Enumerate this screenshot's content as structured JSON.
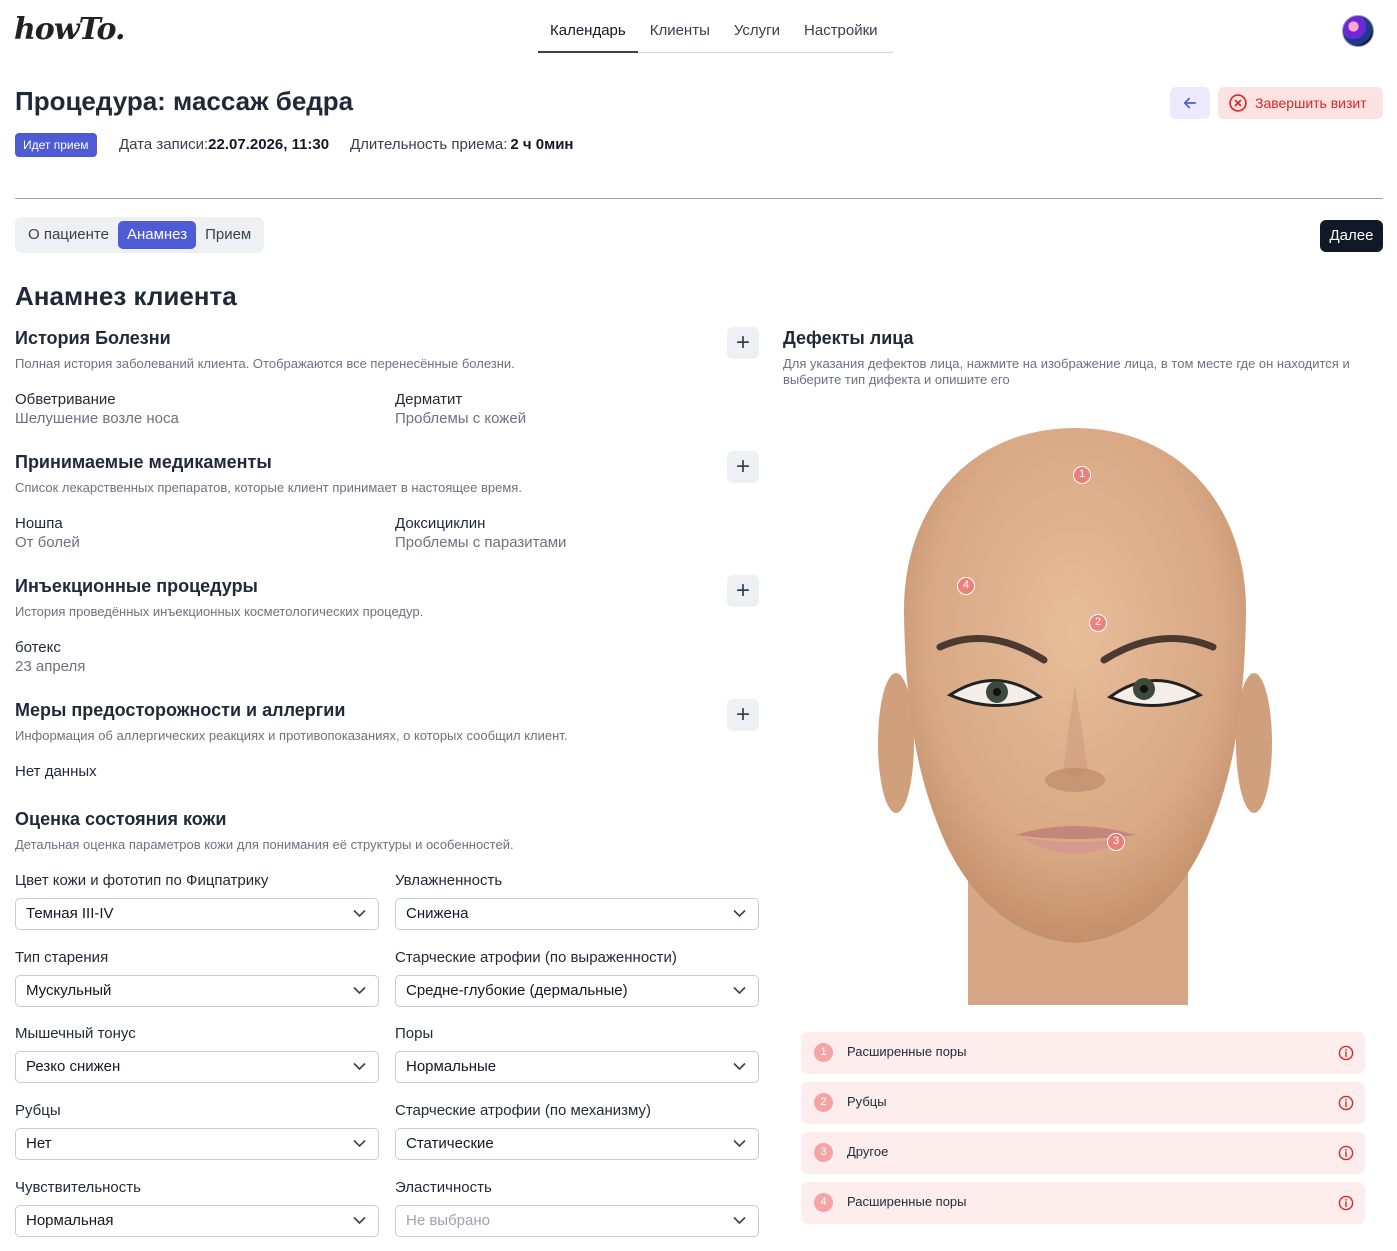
{
  "app": {
    "logo": "howTo."
  },
  "nav": {
    "tabs": [
      "Календарь",
      "Клиенты",
      "Услуги",
      "Настройки"
    ]
  },
  "header": {
    "title": "Процедура: массаж бедра",
    "finish_label": "Завершить визит",
    "status": "Идет прием",
    "date_label": "Дата записи:",
    "date_value": "22.07.2026, 11:30",
    "duration_label": "Длительность приема:",
    "duration_value": "2 ч 0мин"
  },
  "subtabs": [
    "О пациенте",
    "Анамнез",
    "Прием"
  ],
  "next_label": "Далее",
  "section_title": "Анамнез клиента",
  "history": {
    "title": "История Болезни",
    "desc": "Полная история заболеваний клиента. Отображаются все перенесённые болезни.",
    "items": [
      {
        "name": "Обветривание",
        "sub": "Шелушение возле носа"
      },
      {
        "name": "Дерматит",
        "sub": "Проблемы с кожей"
      }
    ]
  },
  "meds": {
    "title": "Принимаемые медикаменты",
    "desc": "Список лекарственных препаратов, которые клиент принимает в настоящее время.",
    "items": [
      {
        "name": "Ношпа",
        "sub": "От болей"
      },
      {
        "name": "Доксициклин",
        "sub": "Проблемы с паразитами"
      }
    ]
  },
  "injections": {
    "title": "Инъекционные процедуры",
    "desc": "История проведённых инъекционных косметологических процедур.",
    "items": [
      {
        "name": "ботекс",
        "sub": "23 апреля"
      }
    ]
  },
  "allergies": {
    "title": "Меры предосторожности и аллергии",
    "desc": "Информация об аллергических реакциях и противопоказаниях, о которых сообщил клиент.",
    "empty": "Нет данных"
  },
  "skin": {
    "title": "Оценка состояния кожи",
    "desc": "Детальная оценка параметров кожи для понимания её структуры и особенностей.",
    "fields": [
      {
        "label": "Цвет кожи и фототип по Фицпатрику",
        "value": "Темная III-IV"
      },
      {
        "label": "Увлажненность",
        "value": "Снижена"
      },
      {
        "label": "Тип старения",
        "value": "Мускульный"
      },
      {
        "label": "Старческие атрофии (по выраженности)",
        "value": "Средне-глубокие (дермальные)"
      },
      {
        "label": "Мышечный тонус",
        "value": "Резко снижен"
      },
      {
        "label": "Поры",
        "value": "Нормальные"
      },
      {
        "label": "Рубцы",
        "value": "Нет"
      },
      {
        "label": "Старческие атрофии (по механизму)",
        "value": "Статические"
      },
      {
        "label": "Чувствительность",
        "value": "Нормальная"
      },
      {
        "label": "Эластичность",
        "value": "Не выбрано"
      }
    ]
  },
  "face_defects": {
    "title": "Дефекты лица",
    "desc_line1": "Для указания дефектов лица, нажмите на изображение лица, в том месте где он находится и",
    "desc_line2": "выберите тип дифекта и опишите его",
    "markers": [
      "1",
      "2",
      "3",
      "4"
    ],
    "list": [
      {
        "num": "1",
        "label": "Расширенные поры"
      },
      {
        "num": "2",
        "label": "Рубцы"
      },
      {
        "num": "3",
        "label": "Другое"
      },
      {
        "num": "4",
        "label": "Расширенные поры"
      }
    ]
  },
  "colors": {
    "accent": "#4f5bd5",
    "danger": "#dc2626",
    "defect_bg": "#fdeded"
  }
}
